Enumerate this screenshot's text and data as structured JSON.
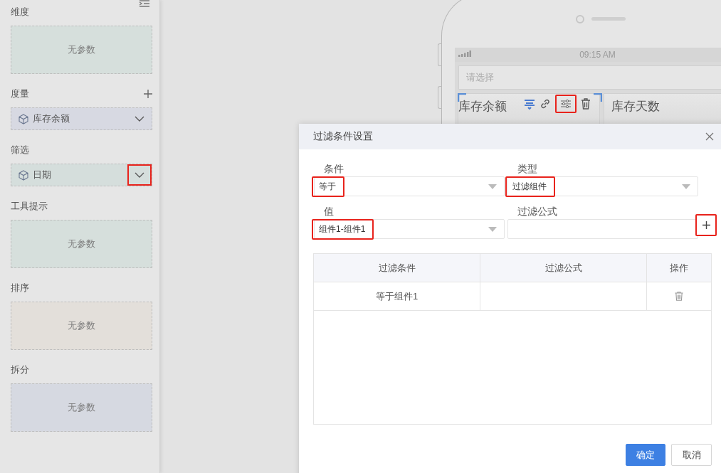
{
  "sidebar": {
    "sections": [
      {
        "title": "维度",
        "kind": "empty",
        "text": "无参数",
        "color": "#d6dfdc",
        "addable": false
      },
      {
        "title": "度量",
        "kind": "field",
        "field": {
          "label": "库存余额",
          "dropdown_highlighted": false
        },
        "color": "#d7d9e2",
        "addable": true
      },
      {
        "title": "筛选",
        "kind": "field",
        "field": {
          "label": "日期",
          "dropdown_highlighted": true
        },
        "color": "#d5dedc",
        "addable": false
      },
      {
        "title": "工具提示",
        "kind": "empty",
        "text": "无参数",
        "color": "#d6dfdc",
        "addable": false
      },
      {
        "title": "排序",
        "kind": "empty",
        "text": "无参数",
        "color": "#e3dfda",
        "addable": false
      },
      {
        "title": "拆分",
        "kind": "empty",
        "text": "无参数",
        "color": "#d6d9e1",
        "addable": false
      }
    ]
  },
  "phone": {
    "status_time": "09:15 AM",
    "select_placeholder": "请选择",
    "settings_highlighted": true,
    "cards": [
      {
        "title": "库存余额",
        "selected": true
      },
      {
        "title": "库存天数",
        "selected": false
      }
    ]
  },
  "dialog": {
    "title": "过滤条件设置",
    "fields": [
      {
        "label": "条件",
        "kind": "select",
        "value": "等于",
        "highlighted": true
      },
      {
        "label": "类型",
        "kind": "select",
        "value": "过滤组件",
        "highlighted": true
      },
      {
        "label": "值",
        "kind": "select",
        "value": "组件1-组件1",
        "highlighted": true
      },
      {
        "label": "过滤公式",
        "kind": "text",
        "highlighted": false
      }
    ],
    "add_highlighted": true,
    "table": {
      "columns": [
        "过滤条件",
        "过滤公式",
        "操作"
      ],
      "rows": [
        {
          "condition": "等于组件1"
        }
      ]
    },
    "buttons": [
      {
        "label": "确定",
        "kind": "primary"
      },
      {
        "label": "取消",
        "kind": "default"
      }
    ]
  }
}
